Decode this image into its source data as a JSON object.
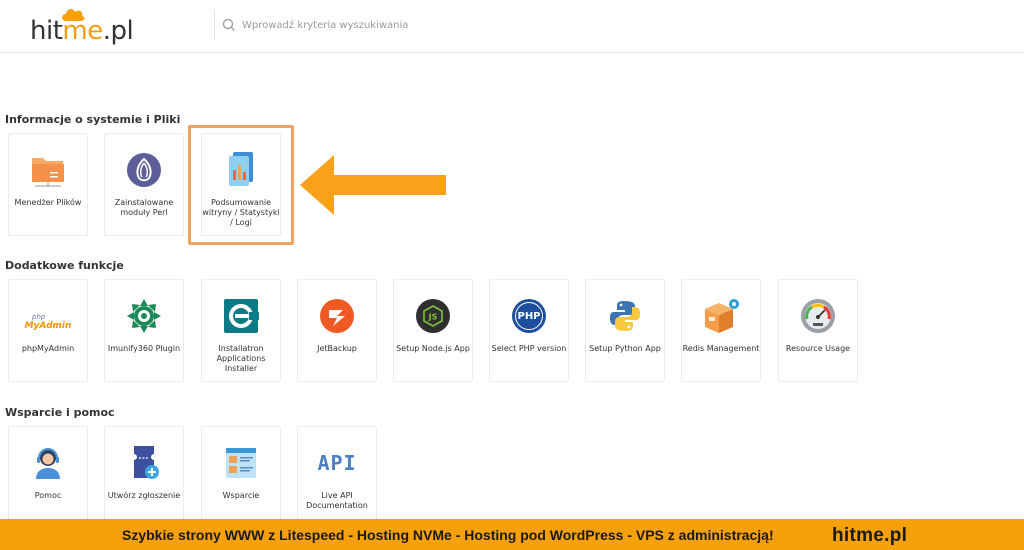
{
  "header": {
    "logo": {
      "part1": "hit",
      "part2": "me",
      "part3": ".pl"
    },
    "search": {
      "placeholder": "Wprowadź kryteria wyszukiwania"
    }
  },
  "sections": {
    "files": {
      "title": "Informacje o systemie i Pliki",
      "items": [
        {
          "label": "Menedżer Plików",
          "icon": "folder-icon"
        },
        {
          "label": "Zainstalowane moduły Perl",
          "icon": "perl-onion-icon"
        },
        {
          "label": "Podsumowanie witryny / Statystyki / Logi",
          "icon": "stats-summary-icon"
        }
      ]
    },
    "extra": {
      "title": "Dodatkowe funkcje",
      "items": [
        {
          "label": "phpMyAdmin",
          "icon": "phpmyadmin-icon",
          "logo_small": "php",
          "logo_big": "MyAdmin"
        },
        {
          "label": "Imunify360 Plugin",
          "icon": "imunify360-icon"
        },
        {
          "label": "Installatron Applications Installer",
          "icon": "installatron-icon"
        },
        {
          "label": "JetBackup",
          "icon": "jetbackup-icon"
        },
        {
          "label": "Setup Node.js App",
          "icon": "nodejs-icon"
        },
        {
          "label": "Select PHP version",
          "icon": "php-icon",
          "logo": "PHP"
        },
        {
          "label": "Setup Python App",
          "icon": "python-icon"
        },
        {
          "label": "Redis Management",
          "icon": "redis-box-icon"
        },
        {
          "label": "Resource Usage",
          "icon": "gauge-icon"
        }
      ]
    },
    "support": {
      "title": "Wsparcie i pomoc",
      "items": [
        {
          "label": "Pomoc",
          "icon": "support-agent-icon"
        },
        {
          "label": "Utwórz zgłoszenie",
          "icon": "create-ticket-icon"
        },
        {
          "label": "Wsparcie",
          "icon": "support-doc-icon"
        },
        {
          "label": "Live API Documentation",
          "icon": "api-icon",
          "logo": "API"
        }
      ]
    }
  },
  "banner": {
    "text": "Szybkie strony WWW z Litespeed - Hosting  NVMe - Hosting pod WordPress - VPS z administracją!",
    "brand": "hitme.pl"
  },
  "colors": {
    "accent": "#f6a00c",
    "highlight": "#f0a35e",
    "arrow": "#f7a21a"
  }
}
